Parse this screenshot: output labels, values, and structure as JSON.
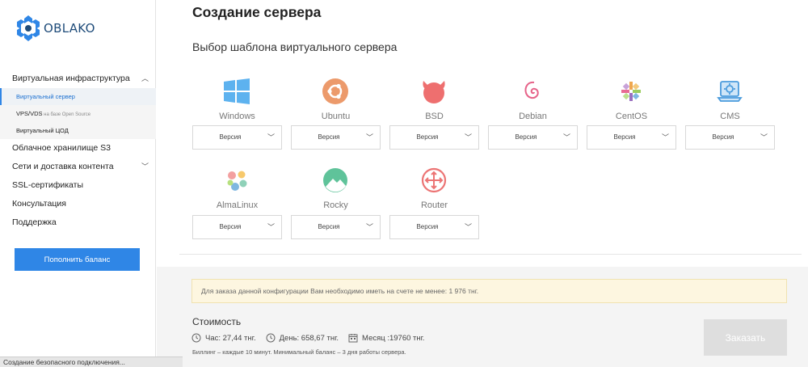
{
  "brand": {
    "name": "OBLAKO"
  },
  "sidebar": {
    "items": [
      {
        "label": "Виртуальная инфраструктура"
      },
      {
        "label": "Виртуальный сервер"
      },
      {
        "label": "VPS/VDS",
        "suffix": " на базе Open Source"
      },
      {
        "label": "Виртуальный ЦОД"
      },
      {
        "label": "Облачное хранилище S3"
      },
      {
        "label": "Сети и доставка контента"
      },
      {
        "label": "SSL-сертификаты"
      },
      {
        "label": "Консультация"
      },
      {
        "label": "Поддержка"
      }
    ],
    "topup_label": "Пополнить баланс"
  },
  "status_bar": {
    "text": "Создание безопасного подключения..."
  },
  "main": {
    "title": "Создание сервера",
    "section_title": "Выбор шаблона виртуального сервера",
    "version_label": "Версия",
    "templates": [
      {
        "name": "Windows",
        "icon": "windows-icon"
      },
      {
        "name": "Ubuntu",
        "icon": "ubuntu-icon"
      },
      {
        "name": "BSD",
        "icon": "bsd-icon"
      },
      {
        "name": "Debian",
        "icon": "debian-icon"
      },
      {
        "name": "CentOS",
        "icon": "centos-icon"
      },
      {
        "name": "CMS",
        "icon": "cms-icon"
      },
      {
        "name": "AlmaLinux",
        "icon": "almalinux-icon"
      },
      {
        "name": "Rocky",
        "icon": "rocky-icon"
      },
      {
        "name": "Router",
        "icon": "router-icon"
      }
    ]
  },
  "order": {
    "notice": "Для заказа данной конфигурации Вам необходимо иметь на счете не менее: 1 976 тнг.",
    "cost_title": "Стоимость",
    "hour": "Час: 27,44 тнг.",
    "day": "День: 658,67 тнг.",
    "month": "Месяц :19760 тнг.",
    "billing_note": "Биллинг – каждые 10 минут. Минимальный баланс – 3 дня работы сервера.",
    "order_label": "Заказать"
  },
  "colors": {
    "accent": "#2f86e6",
    "disabled": "#dedede"
  }
}
